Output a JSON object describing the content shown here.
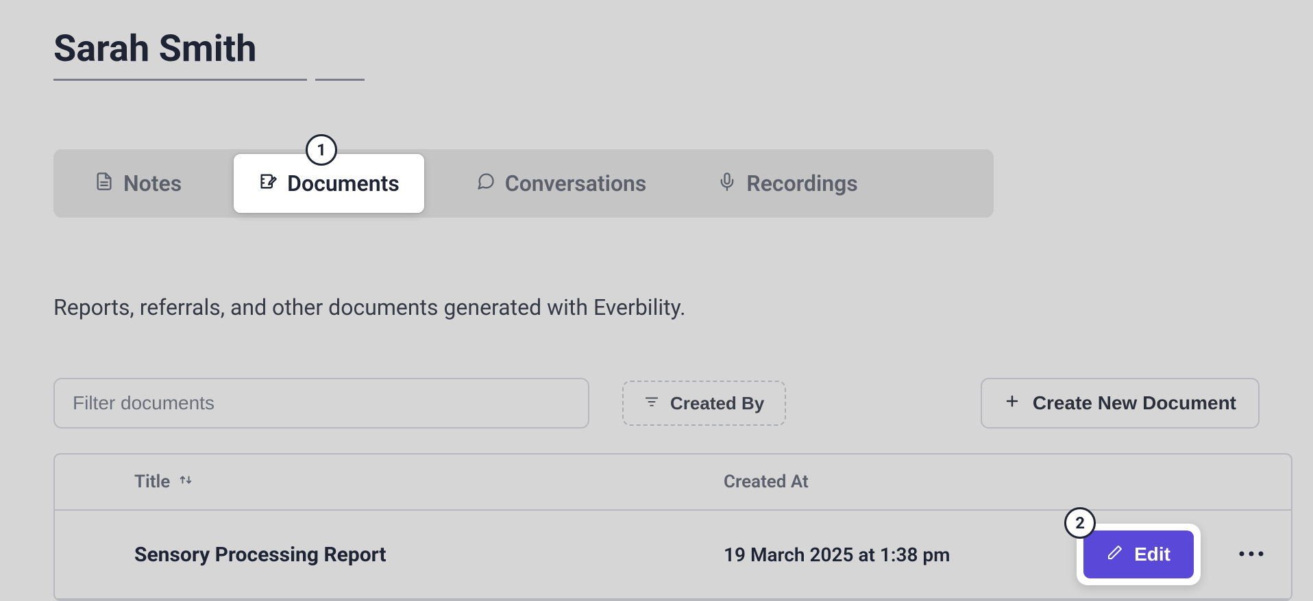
{
  "page": {
    "title": "Sarah Smith"
  },
  "tabs": {
    "notes": "Notes",
    "documents": "Documents",
    "conversations": "Conversations",
    "recordings": "Recordings",
    "active": "documents"
  },
  "callouts": {
    "one": "1",
    "two": "2"
  },
  "description": "Reports, referrals, and other documents generated with Everbility.",
  "toolbar": {
    "filter_placeholder": "Filter documents",
    "created_by_label": "Created By",
    "create_doc_label": "Create New Document"
  },
  "table": {
    "headers": {
      "title": "Title",
      "created_at": "Created At"
    },
    "rows": [
      {
        "title": "Sensory Processing Report",
        "created_at": "19 March 2025 at 1:38 pm",
        "edit_label": "Edit"
      }
    ]
  }
}
